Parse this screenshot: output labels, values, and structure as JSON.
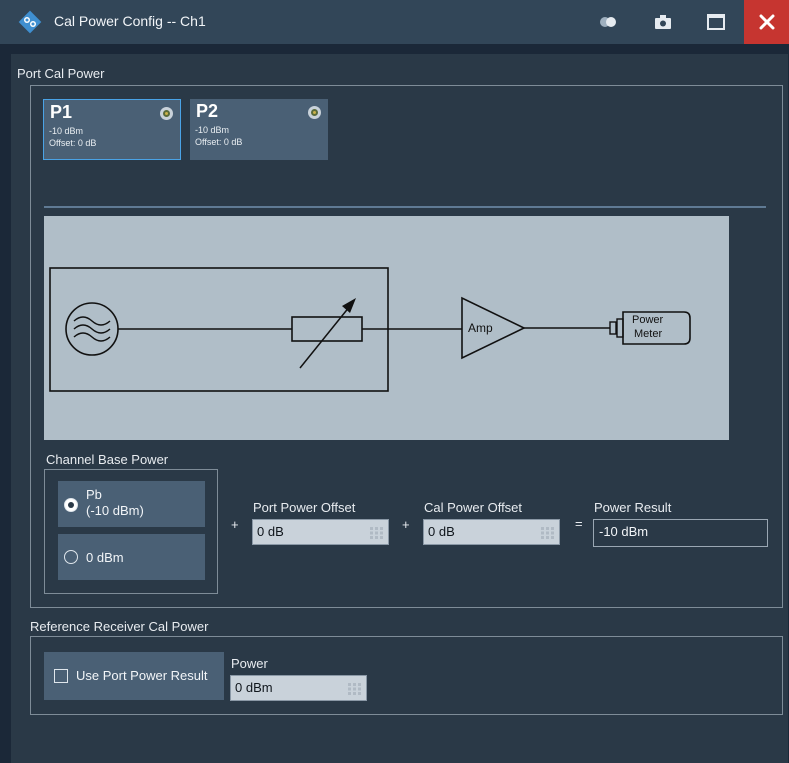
{
  "window": {
    "title": "Cal Power Config -- Ch1",
    "icons": [
      "rohde-schwarz-logo",
      "toggle-icon",
      "camera-icon",
      "maximize-icon",
      "close-icon"
    ]
  },
  "port_cal_power": {
    "label": "Port Cal Power",
    "ports": [
      {
        "name": "P1",
        "power": "-10 dBm",
        "offset": "Offset: 0 dB",
        "selected": true
      },
      {
        "name": "P2",
        "power": "-10 dBm",
        "offset": "Offset: 0 dB",
        "selected": false
      }
    ],
    "diagram": {
      "amp_label": "Amp",
      "meter_label_1": "Power",
      "meter_label_2": "Meter"
    },
    "channel_base_power": {
      "label": "Channel Base Power",
      "option_pb_1": "Pb",
      "option_pb_2": "(-10 dBm)",
      "option_zero": "0 dBm",
      "selected": "pb"
    },
    "plus": "+",
    "equals": "=",
    "port_power_offset": {
      "label": "Port Power Offset",
      "value": "0 dB"
    },
    "cal_power_offset": {
      "label": "Cal Power Offset",
      "value": "0 dB"
    },
    "power_result": {
      "label": "Power Result",
      "value": "-10 dBm"
    }
  },
  "reference_receiver": {
    "label": "Reference Receiver Cal Power",
    "use_port_power_label": "Use Port Power Result",
    "use_port_power_checked": false,
    "power_label": "Power",
    "power_value": "0 dBm"
  },
  "colors": {
    "background": "#1b2838",
    "panel": "#2a3947",
    "titlebar": "#324658",
    "card": "#4a6075",
    "selected_border": "#4aa3e6",
    "close": "#c63530",
    "diagram_bg": "#b0bec8"
  }
}
